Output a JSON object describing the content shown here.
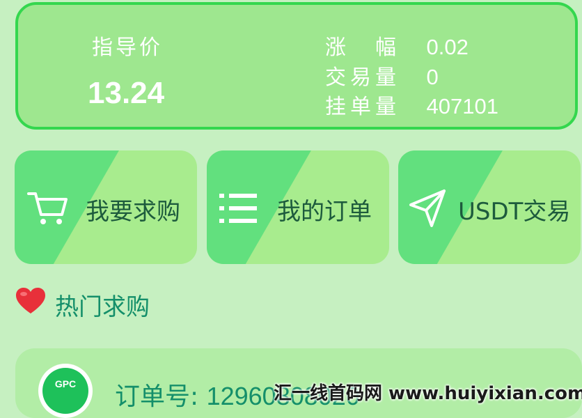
{
  "price": {
    "guide_label": "指导价",
    "guide_value": "13.24",
    "stats": [
      {
        "label": "涨　幅",
        "value": "0.02"
      },
      {
        "label": "交易量",
        "value": "0"
      },
      {
        "label": "挂单量",
        "value": "407101"
      }
    ]
  },
  "actions": [
    {
      "label": "我要求购",
      "icon": "cart-icon"
    },
    {
      "label": "我的订单",
      "icon": "list-icon"
    },
    {
      "label": "USDT交易",
      "icon": "send-icon"
    }
  ],
  "hot": {
    "title": "热门求购",
    "icon": "heart-icon"
  },
  "order": {
    "logo_text": "GPC",
    "label": "订单号:",
    "number": "12960808020"
  },
  "watermark": "汇一线首码网 www.huiyixian.com"
}
